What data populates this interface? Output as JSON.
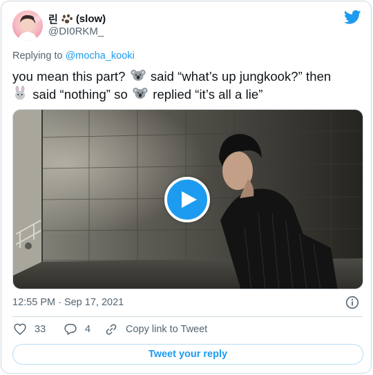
{
  "author": {
    "display_name": "린",
    "name_suffix": "(slow)",
    "name_emoji_icon": "paw-prints-icon",
    "handle": "@DI0RKM_"
  },
  "reply_context": {
    "prefix": "Replying to ",
    "mention": "@mocha_kooki"
  },
  "tweet": {
    "line1_a": "you mean this part?",
    "line1_b": "said “what’s up jungkook?” then",
    "line2_a": "said “nothing” so",
    "line2_b": "replied “it’s all a lie”",
    "emoji_1": "koala-icon",
    "emoji_2": "rabbit-icon",
    "emoji_3": "koala-icon"
  },
  "media": {
    "type": "video",
    "play_icon": "play-icon"
  },
  "timestamp": "12:55 PM · Sep 17, 2021",
  "actions": {
    "like_count": "33",
    "reply_count": "4",
    "copy_link_label": "Copy link to Tweet"
  },
  "reply_button_label": "Tweet your reply",
  "colors": {
    "accent": "#1d9bf0",
    "text_primary": "#0f1419",
    "text_secondary": "#536471",
    "border": "#cfd9de"
  }
}
